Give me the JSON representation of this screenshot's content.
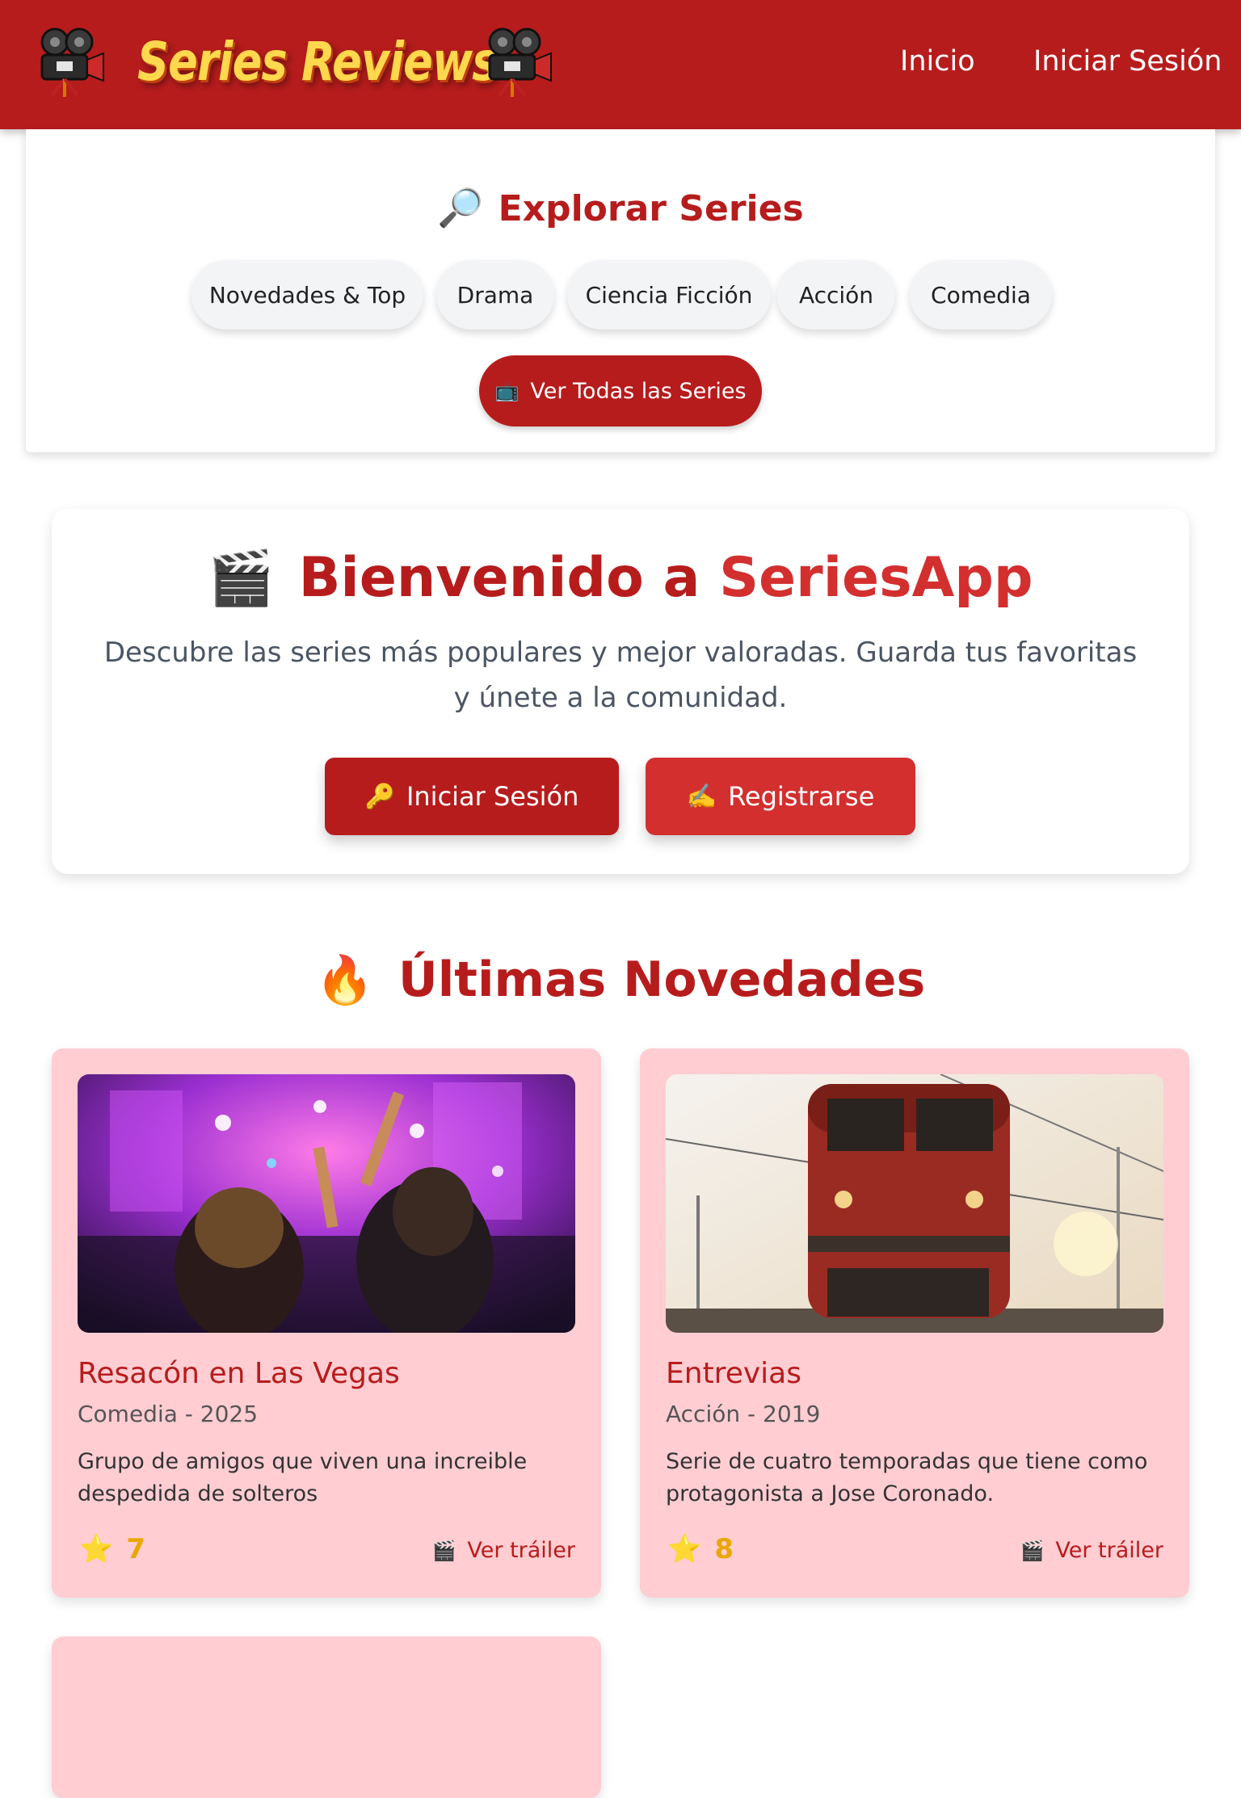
{
  "header": {
    "logo": "Series Reviews",
    "nav": {
      "home": "Inicio",
      "login": "Iniciar Sesión"
    }
  },
  "explore": {
    "icon": "🔎",
    "title": "Explorar Series",
    "categories": [
      "Novedades & Top",
      "Drama",
      "Ciencia Ficción",
      "Acción",
      "Comedia"
    ],
    "all_icon": "📺",
    "all_label": "Ver Todas las Series"
  },
  "welcome": {
    "icon": "🎬",
    "title_prefix": "Bienvenido a ",
    "title_brand": "SeriesApp",
    "description": "Descubre las series más populares y mejor valoradas. Guarda tus favoritas y únete a la comunidad.",
    "login_icon": "🔑",
    "login_label": "Iniciar Sesión",
    "register_icon": "✍️",
    "register_label": "Registrarse"
  },
  "latest": {
    "icon": "🔥",
    "title": "Últimas Novedades",
    "star_icon": "⭐",
    "trailer_icon": "🎬",
    "cards": [
      {
        "title": "Resacón en Las Vegas",
        "meta": "Comedia - 2025",
        "description": "Grupo de amigos que viven una increible despedida de solteros",
        "rating": "7",
        "trailer": "Ver tráiler"
      },
      {
        "title": "Entrevias",
        "meta": "Acción - 2019",
        "description": "Serie de cuatro temporadas que tiene como protagonista a Jose Coronado.",
        "rating": "8",
        "trailer": "Ver tráiler"
      }
    ]
  },
  "colors": {
    "primary": "#b71c1c",
    "accent": "#d32f2f",
    "card_bg": "#ffcdd2",
    "logo_yellow": "#ffd84d",
    "rating": "#e8a800"
  },
  "icons": {
    "header_logo_left": "movie-camera-icon",
    "header_logo_right": "movie-camera-icon"
  }
}
